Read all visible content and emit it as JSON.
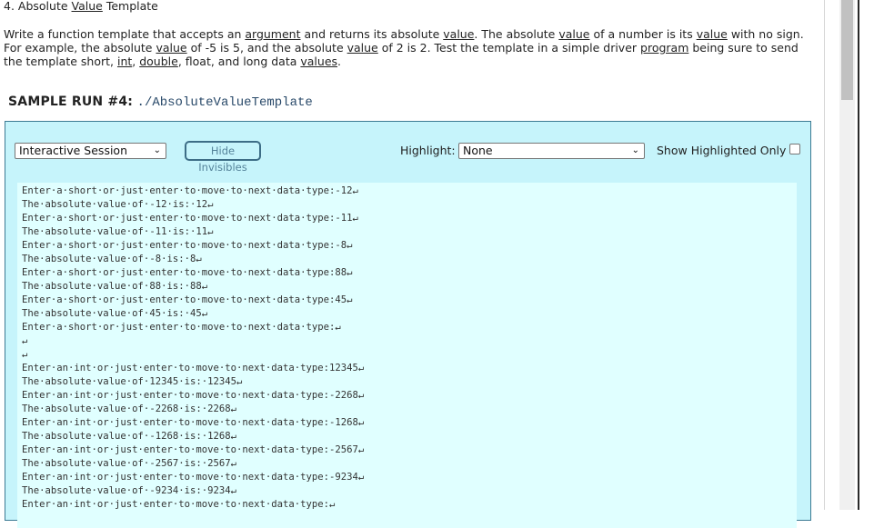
{
  "problem": {
    "number": "4.",
    "title_pre": " Absolute ",
    "title_link": "Value",
    "title_post": " Template",
    "desc_parts": [
      {
        "t": "Write a function template that accepts an "
      },
      {
        "t": "argument",
        "u": true
      },
      {
        "t": " and returns its absolute "
      },
      {
        "t": "value",
        "u": true
      },
      {
        "t": ". The absolute "
      },
      {
        "t": "value",
        "u": true
      },
      {
        "t": " of a number is its "
      },
      {
        "t": "value",
        "u": true
      },
      {
        "t": " with no sign. For example, the absolute "
      },
      {
        "t": "value",
        "u": true
      },
      {
        "t": " of -5 is 5, and the absolute "
      },
      {
        "t": "value",
        "u": true
      },
      {
        "t": " of 2 is 2. Test the template in a simple driver "
      },
      {
        "t": "program",
        "u": true
      },
      {
        "t": " being sure to send the template short, "
      },
      {
        "t": "int",
        "u": true
      },
      {
        "t": ", "
      },
      {
        "t": "double",
        "u": true
      },
      {
        "t": ", float, and long data "
      },
      {
        "t": "values",
        "u": true
      },
      {
        "t": "."
      }
    ]
  },
  "sample_run": {
    "label": "SAMPLE RUN #4:",
    "command": "./AbsoluteValueTemplate"
  },
  "toolbar": {
    "session_select": "Interactive Session",
    "hide_invisibles": "Hide Invisibles",
    "highlight_label": "Highlight:",
    "highlight_select": "None",
    "show_highlighted_only": "Show Highlighted Only",
    "show_highlighted_checked": false,
    "chevron": "❯"
  },
  "output_lines": [
    "Enter·a·short·or·just·enter·to·move·to·next·data·type:-12↵",
    "The·absolute·value·of·-12·is:·12↵",
    "Enter·a·short·or·just·enter·to·move·to·next·data·type:-11↵",
    "The·absolute·value·of·-11·is:·11↵",
    "Enter·a·short·or·just·enter·to·move·to·next·data·type:-8↵",
    "The·absolute·value·of·-8·is:·8↵",
    "Enter·a·short·or·just·enter·to·move·to·next·data·type:88↵",
    "The·absolute·value·of·88·is:·88↵",
    "Enter·a·short·or·just·enter·to·move·to·next·data·type:45↵",
    "The·absolute·value·of·45·is:·45↵",
    "Enter·a·short·or·just·enter·to·move·to·next·data·type:↵",
    "↵",
    "↵",
    "Enter·an·int·or·just·enter·to·move·to·next·data·type:12345↵",
    "The·absolute·value·of·12345·is:·12345↵",
    "Enter·an·int·or·just·enter·to·move·to·next·data·type:-2268↵",
    "The·absolute·value·of·-2268·is:·2268↵",
    "Enter·an·int·or·just·enter·to·move·to·next·data·type:-1268↵",
    "The·absolute·value·of·-1268·is:·1268↵",
    "Enter·an·int·or·just·enter·to·move·to·next·data·type:-2567↵",
    "The·absolute·value·of·-2567·is:·2567↵",
    "Enter·an·int·or·just·enter·to·move·to·next·data·type:-9234↵",
    "The·absolute·value·of·-9234·is:·9234↵",
    "Enter·an·int·or·just·enter·to·move·to·next·data·type:↵"
  ],
  "colors": {
    "panel_bg": "#c6f4fb",
    "panel_border": "#3c7a93",
    "output_bg": "#e0ffff",
    "button_border": "#3d6d86"
  }
}
